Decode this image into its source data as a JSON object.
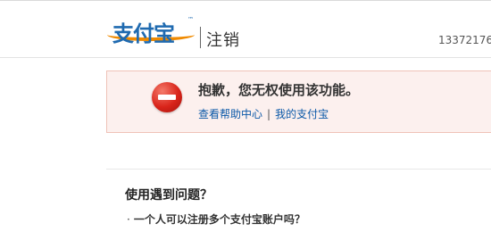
{
  "header": {
    "logo_text": "支付宝",
    "logo_tm": "™",
    "section_title": "注销",
    "account": "13372176"
  },
  "notice": {
    "message": "抱歉，您无权使用该功能。",
    "links": [
      {
        "label": "查看帮助中心"
      },
      {
        "label": "我的支付宝"
      }
    ],
    "separator": "|"
  },
  "faq": {
    "title": "使用遇到问题？",
    "items": [
      {
        "bullet": "·",
        "text": "一个人可以注册多个支付宝账户吗？"
      }
    ]
  },
  "colors": {
    "brand_blue": "#1f6ab0",
    "brand_orange": "#f08a00",
    "error_red": "#d9241a",
    "notice_bg": "#fcf0ee",
    "link_blue": "#0a58a8"
  }
}
